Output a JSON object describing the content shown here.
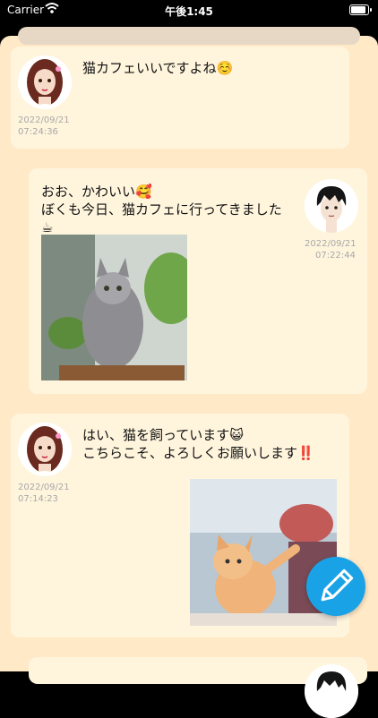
{
  "status_bar": {
    "carrier": "Carrier",
    "time": "午後1:45"
  },
  "messages": [
    {
      "text": "猫カフェいいですよね☺️",
      "date": "2022/09/21",
      "time": "07:24:36",
      "avatar": "female-avatar"
    },
    {
      "text": "おお、かわいい🥰\nぼくも今日、猫カフェに行ってきました☕",
      "date": "2022/09/21",
      "time": "07:22:44",
      "avatar": "male-avatar",
      "photo": "grey-longhair-cat-photo"
    },
    {
      "text": "はい、猫を飼っています😺\nこちらこそ、よろしくお願いします‼️",
      "date": "2022/09/21",
      "time": "07:14:23",
      "avatar": "female-avatar",
      "photo": "orange-kitten-photo"
    }
  ],
  "compose_button": {
    "icon": "pencil-icon",
    "color": "#1aa2e6"
  },
  "colors": {
    "sheet": "#ffe9c7",
    "card": "#fff5dd"
  }
}
